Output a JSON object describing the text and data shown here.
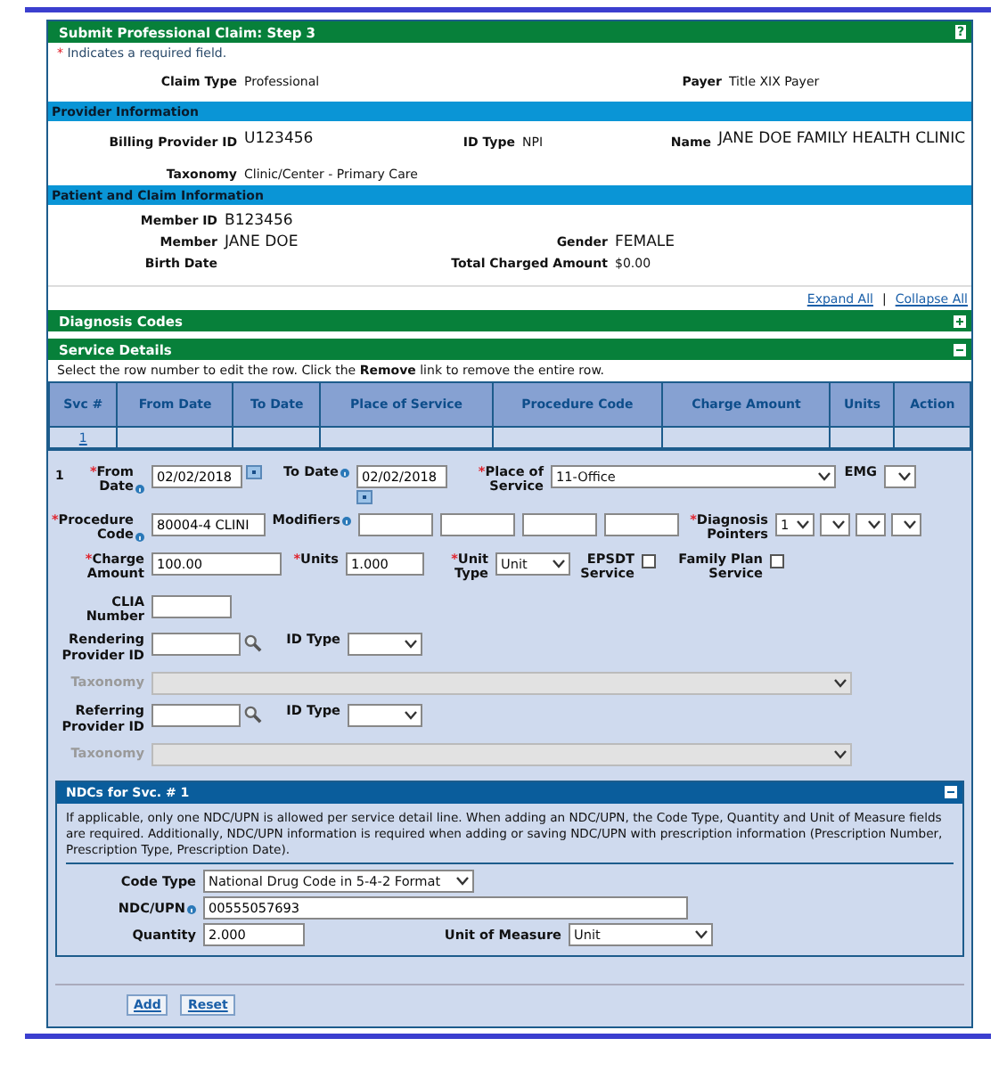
{
  "title": "Submit Professional Claim: Step 3",
  "help": "?",
  "required_note": {
    "mark": "*",
    "text": "Indicates a required field."
  },
  "claim": {
    "claim_type": {
      "label": "Claim Type",
      "value": "Professional"
    },
    "payer": {
      "label": "Payer",
      "value": "Title XIX Payer"
    }
  },
  "provider": {
    "heading": "Provider Information",
    "billing_id": {
      "label": "Billing Provider ID",
      "value": "U123456"
    },
    "id_type": {
      "label": "ID Type",
      "value": "NPI"
    },
    "name": {
      "label": "Name",
      "value": "JANE DOE FAMILY HEALTH CLINIC"
    },
    "taxonomy": {
      "label": "Taxonomy",
      "value": "Clinic/Center - Primary Care"
    }
  },
  "patient": {
    "heading": "Patient and Claim Information",
    "member_id": {
      "label": "Member ID",
      "value": "B123456"
    },
    "member": {
      "label": "Member",
      "value": "JANE DOE"
    },
    "birth_date": {
      "label": "Birth Date"
    },
    "gender": {
      "label": "Gender",
      "value": "FEMALE"
    },
    "total": {
      "label": "Total Charged Amount",
      "value": "$0.00"
    }
  },
  "links": {
    "expand_all": "Expand All",
    "separator": "|",
    "collapse_all": "Collapse All"
  },
  "sections": [
    {
      "heading": "Diagnosis Codes",
      "expanded": false
    },
    {
      "heading": "Service Details",
      "expanded": true
    }
  ],
  "instruction": "Select the row number to edit the row. Click the **Remove** link to remove the entire row.",
  "table": {
    "columns": [
      "Svc #",
      "From Date",
      "To Date",
      "Place of Service",
      "Procedure Code",
      "Charge Amount",
      "Units",
      "Action"
    ],
    "rows": [
      {
        "cells": [
          "1"
        ]
      }
    ]
  },
  "detail": {
    "row_number": "1",
    "from_date": {
      "label": "From Date",
      "required_mark": "*",
      "info": true,
      "value": "02/02/2018"
    },
    "to_date": {
      "label": "To Date",
      "info": true,
      "value": "02/02/2018"
    },
    "place": {
      "label": "Place of Service",
      "required_mark": "*",
      "value": "11-Office"
    },
    "emg": {
      "label": "EMG"
    },
    "procedure": {
      "label": "Procedure Code",
      "required_mark": "*",
      "info": true,
      "value": "80004-4 CLINI"
    },
    "modifiers": {
      "label": "Modifiers",
      "info": true,
      "inputs": [
        {
          "kind": "text"
        },
        {
          "kind": "text"
        },
        {
          "kind": "text"
        },
        {
          "kind": "text"
        }
      ]
    },
    "pointers": {
      "label": "Diagnosis Pointers",
      "required_mark": "*",
      "selects": [
        {
          "kind": "select",
          "value": "1"
        },
        {
          "kind": "select"
        },
        {
          "kind": "select"
        },
        {
          "kind": "select"
        }
      ]
    },
    "charge": {
      "label": "Charge Amount",
      "required_mark": "*",
      "value": "100.00"
    },
    "units": {
      "label": "Units",
      "required_mark": "*",
      "value": "1.000"
    },
    "unit_type": {
      "label": "Unit Type",
      "required_mark": "*",
      "value": "Unit"
    },
    "epsdt": {
      "label": "EPSDT Service",
      "checked": false
    },
    "family_plan": {
      "label": "Family Plan Service",
      "checked": false
    },
    "clia": {
      "label": "CLIA Number"
    },
    "providers": [
      {
        "label": "Rendering Provider ID",
        "id_type": "ID Type",
        "taxonomy": {
          "label": "Taxonomy",
          "disabled": true
        }
      },
      {
        "label": "Referring Provider ID",
        "id_type": "ID Type",
        "taxonomy": {
          "label": "Taxonomy",
          "disabled": true
        }
      }
    ]
  },
  "ndc": {
    "heading": "NDCs for Svc. # 1",
    "expanded": true,
    "note": "If applicable, only one NDC/UPN is allowed per service detail line. When adding an NDC/UPN, the Code Type, Quantity and Unit of Measure fields are required. Additionally, NDC/UPN information is required when adding or saving NDC/UPN with prescription information (Prescription Number, Prescription Type, Prescription Date).",
    "code_type": {
      "label": "Code Type",
      "value": "National Drug Code in 5-4-2 Format"
    },
    "ndc_upn": {
      "label": "NDC/UPN",
      "info": true,
      "value": "00555057693"
    },
    "quantity": {
      "label": "Quantity",
      "value": "2.000"
    },
    "unit_of_measure": {
      "label": "Unit of Measure",
      "value": "Unit"
    }
  },
  "buttons": [
    "Add",
    "Reset"
  ]
}
